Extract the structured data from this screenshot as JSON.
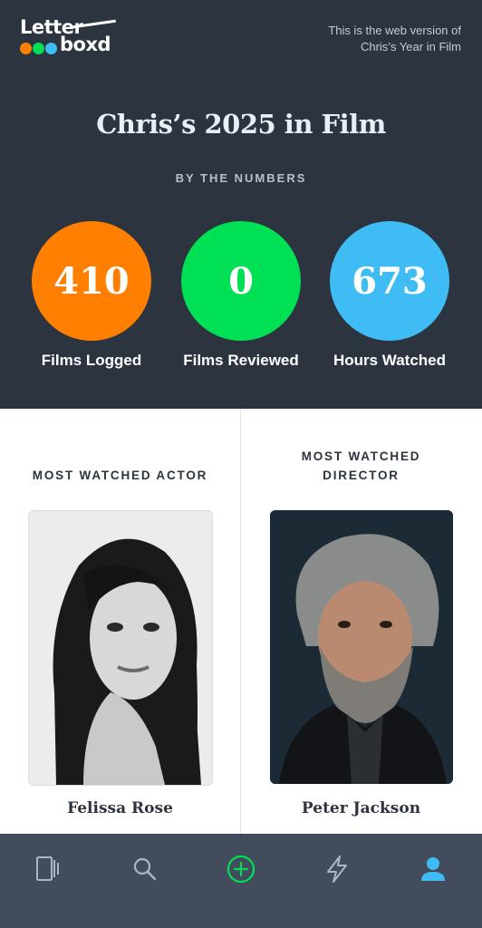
{
  "brand": {
    "logo_line1": "Letter",
    "logo_line2": "boxd",
    "dot_colors": [
      "#ff8000",
      "#00e054",
      "#40bcf4"
    ]
  },
  "notice": {
    "line1": "This is the web version of",
    "line2": "Chris’s Year in Film"
  },
  "header": {
    "title": "Chris’s 2025 in Film",
    "subtitle": "BY THE NUMBERS"
  },
  "stats": [
    {
      "value": "410",
      "label": "Films Logged",
      "color": "#ff8000"
    },
    {
      "value": "0",
      "label": "Films Reviewed",
      "color": "#00e054"
    },
    {
      "value": "673",
      "label": "Hours Watched",
      "color": "#40bcf4"
    }
  ],
  "actor": {
    "heading_line1": "MOST WATCHED ACTOR",
    "name": "Felissa Rose"
  },
  "director": {
    "heading_line1": "MOST WATCHED",
    "heading_line2": "DIRECTOR",
    "name": "Peter Jackson"
  },
  "nav": {
    "items": [
      "films-icon",
      "search-icon",
      "add-icon",
      "activity-icon",
      "profile-icon"
    ],
    "active": "profile-icon"
  }
}
